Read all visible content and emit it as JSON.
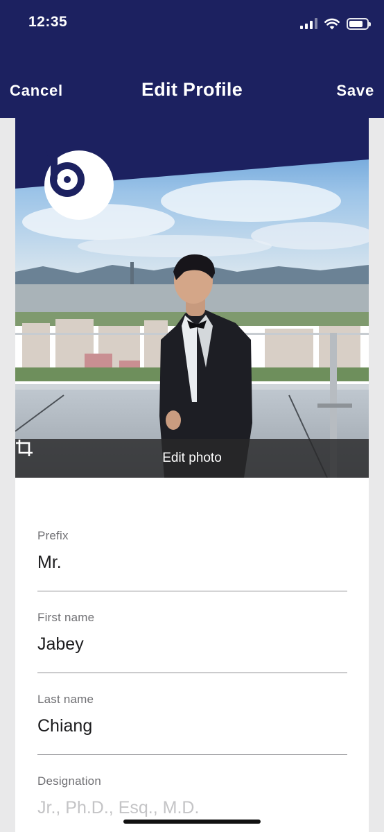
{
  "status_bar": {
    "time": "12:35",
    "icons": [
      "signal-icon",
      "wifi-icon",
      "battery-icon"
    ]
  },
  "nav": {
    "cancel_label": "Cancel",
    "title": "Edit Profile",
    "save_label": "Save"
  },
  "profile": {
    "logo_icon": "brand-b-logo-icon",
    "edit_photo_label": "Edit photo",
    "edit_photo_icon": "crop-icon"
  },
  "form": {
    "prefix": {
      "label": "Prefix",
      "value": "Mr."
    },
    "first_name": {
      "label": "First name",
      "value": "Jabey"
    },
    "last_name": {
      "label": "Last name",
      "value": "Chiang"
    },
    "designation": {
      "label": "Designation",
      "placeholder": "Jr., Ph.D., Esq., M.D."
    }
  },
  "colors": {
    "header_bg": "#1c2160",
    "card_bg": "#ffffff",
    "page_bg": "#e9e9ea"
  }
}
